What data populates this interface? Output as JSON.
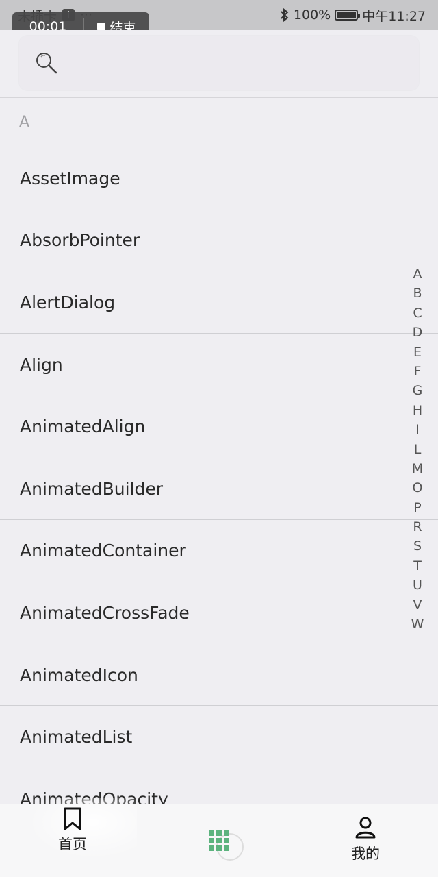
{
  "status_bar": {
    "left_text": "未插卡",
    "battery": "100%",
    "time": "中午11:27",
    "more": "···"
  },
  "recording": {
    "time": "00:01",
    "end_label": "结束"
  },
  "search": {
    "placeholder": ""
  },
  "list": {
    "section": "A",
    "items": [
      "AssetImage",
      "AbsorbPointer",
      "AlertDialog",
      "Align",
      "AnimatedAlign",
      "AnimatedBuilder",
      "AnimatedContainer",
      "AnimatedCrossFade",
      "AnimatedIcon",
      "AnimatedList",
      "AnimatedOpacity"
    ]
  },
  "alphabet_index": [
    "A",
    "B",
    "C",
    "D",
    "E",
    "F",
    "G",
    "H",
    "I",
    "L",
    "M",
    "O",
    "P",
    "R",
    "S",
    "T",
    "U",
    "V",
    "W"
  ],
  "bottom_nav": {
    "home_label": "首页",
    "mine_label": "我的",
    "accent_color": "#5cb37e"
  }
}
